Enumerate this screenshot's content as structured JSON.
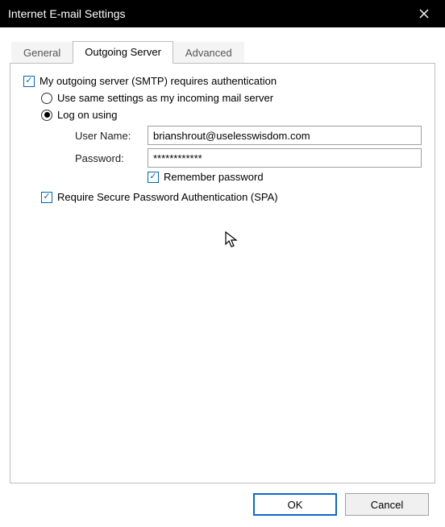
{
  "window": {
    "title": "Internet E-mail Settings"
  },
  "tabs": {
    "general": "General",
    "outgoing": "Outgoing Server",
    "advanced": "Advanced"
  },
  "panel": {
    "smtp_auth_label": "My outgoing server (SMTP) requires authentication",
    "use_same_label": "Use same settings as my incoming mail server",
    "log_on_label": "Log on using",
    "username_label": "User Name:",
    "username_value": "brianshrout@uselesswisdom.com",
    "password_label": "Password:",
    "password_value": "************",
    "remember_label": "Remember password",
    "spa_label": "Require Secure Password Authentication (SPA)"
  },
  "buttons": {
    "ok": "OK",
    "cancel": "Cancel"
  }
}
